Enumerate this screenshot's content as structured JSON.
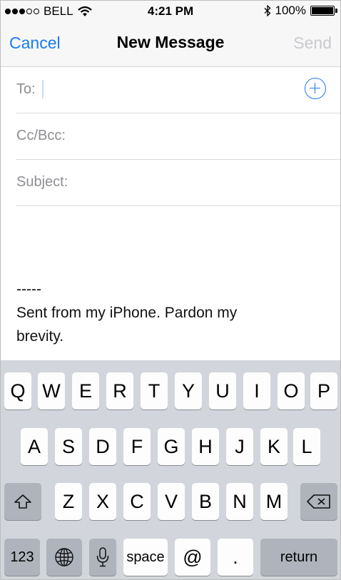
{
  "status_bar": {
    "carrier": "BELL",
    "time": "4:21 PM",
    "battery": "100%",
    "icons": [
      "signal-dots",
      "wifi-icon",
      "bluetooth-icon",
      "battery-icon"
    ]
  },
  "nav": {
    "cancel": "Cancel",
    "title": "New Message",
    "send": "Send"
  },
  "fields": {
    "to": "To:",
    "ccbcc": "Cc/Bcc:",
    "subject": "Subject:"
  },
  "body": {
    "separator": "-----",
    "signature_line1": "Sent from my iPhone. Pardon my",
    "signature_line2": "brevity."
  },
  "keyboard": {
    "row1": [
      "Q",
      "W",
      "E",
      "R",
      "T",
      "Y",
      "U",
      "I",
      "O",
      "P"
    ],
    "row2": [
      "A",
      "S",
      "D",
      "F",
      "G",
      "H",
      "J",
      "K",
      "L"
    ],
    "row3": [
      "Z",
      "X",
      "C",
      "V",
      "B",
      "N",
      "M"
    ],
    "numbers": "123",
    "space": "space",
    "at": "@",
    "period": ".",
    "return": "return",
    "icons": [
      "shift-icon",
      "backspace-icon",
      "globe-icon",
      "mic-icon"
    ]
  },
  "colors": {
    "accent": "#1a7cf4",
    "disabled": "#c9c9ce",
    "keyboard_bg": "#d2d5db"
  }
}
